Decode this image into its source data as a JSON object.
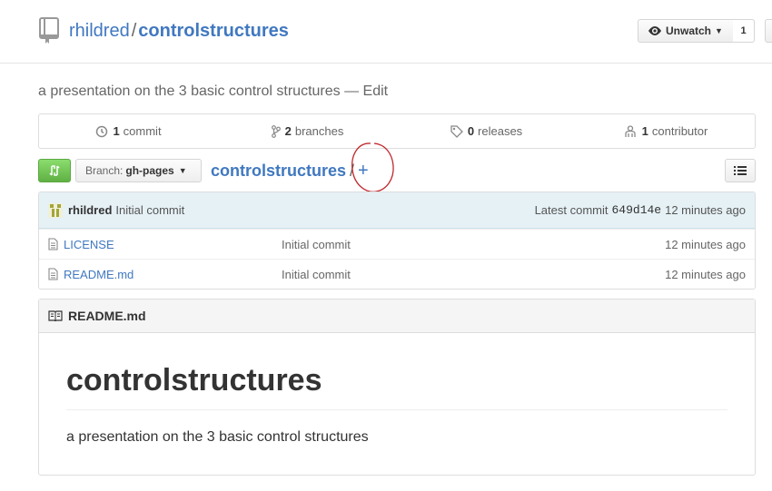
{
  "header": {
    "owner": "rhildred",
    "separator": "/",
    "repo": "controlstructures",
    "unwatch_label": "Unwatch",
    "watch_count": "1"
  },
  "description": {
    "text": "a presentation on the 3 basic control structures",
    "dash": "—",
    "edit_label": "Edit"
  },
  "stats": {
    "commits_num": "1",
    "commits_label": "commit",
    "branches_num": "2",
    "branches_label": "branches",
    "releases_num": "0",
    "releases_label": "releases",
    "contributors_num": "1",
    "contributors_label": "contributor"
  },
  "file_nav": {
    "branch_prefix": "Branch:",
    "branch_name": "gh-pages",
    "breadcrumb_repo": "controlstructures",
    "breadcrumb_sep": "/",
    "add_file": "+"
  },
  "commit_tease": {
    "author": "rhildred",
    "message": "Initial commit",
    "latest_label": "Latest commit",
    "sha": "649d14e",
    "age": "12 minutes ago"
  },
  "files": [
    {
      "name": "LICENSE",
      "message": "Initial commit",
      "age": "12 minutes ago"
    },
    {
      "name": "README.md",
      "message": "Initial commit",
      "age": "12 minutes ago"
    }
  ],
  "readme": {
    "filename": "README.md",
    "heading": "controlstructures",
    "paragraph": "a presentation on the 3 basic control structures"
  },
  "colors": {
    "link": "#4078c0",
    "compare_green": "#60b044",
    "annotation_red": "#c0282d"
  }
}
